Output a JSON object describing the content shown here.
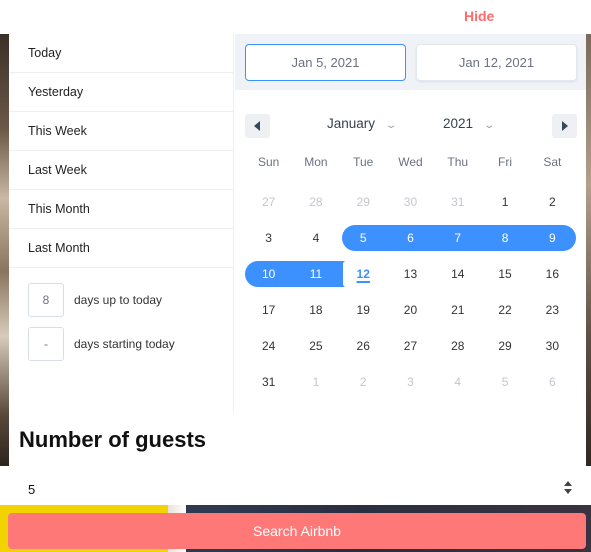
{
  "topbar": {
    "hide_label": "Hide"
  },
  "quick_ranges": [
    "Today",
    "Yesterday",
    "This Week",
    "Last Week",
    "This Month",
    "Last Month"
  ],
  "custom_ranges": [
    {
      "value": "8",
      "label": "days up to today"
    },
    {
      "value": "-",
      "label": "days starting today"
    }
  ],
  "date_inputs": {
    "start": "Jan 5, 2021",
    "end": "Jan 12, 2021"
  },
  "calendar": {
    "month": "January",
    "year": "2021",
    "weekdays": [
      "Sun",
      "Mon",
      "Tue",
      "Wed",
      "Thu",
      "Fri",
      "Sat"
    ],
    "weeks": [
      [
        "27",
        "28",
        "29",
        "30",
        "31",
        "1",
        "2"
      ],
      [
        "3",
        "4",
        "5",
        "6",
        "7",
        "8",
        "9"
      ],
      [
        "10",
        "11",
        "12",
        "13",
        "14",
        "15",
        "16"
      ],
      [
        "17",
        "18",
        "19",
        "20",
        "21",
        "22",
        "23"
      ],
      [
        "24",
        "25",
        "26",
        "27",
        "28",
        "29",
        "30"
      ],
      [
        "31",
        "1",
        "2",
        "3",
        "4",
        "5",
        "6"
      ]
    ]
  },
  "guests": {
    "title": "Number of guests",
    "value": "5"
  },
  "search": {
    "label": "Search Airbnb"
  },
  "colors": {
    "accent": "#3d91ff",
    "hide": "#ff6b6b",
    "search": "#ff7878"
  }
}
